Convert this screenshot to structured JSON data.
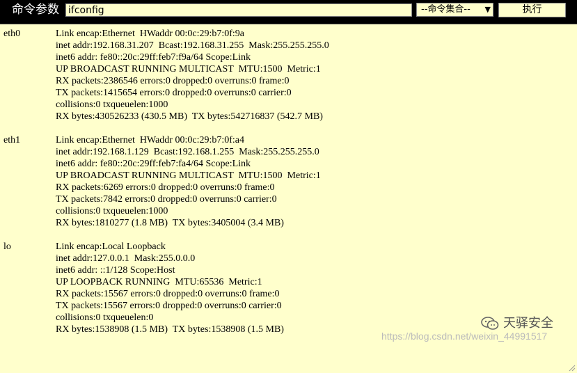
{
  "toolbar": {
    "label": "命令参数",
    "command_value": "ifconfig",
    "select_value": "--命令集合--",
    "exec_label": "执行"
  },
  "output": {
    "blocks": [
      {
        "iface": "eth0",
        "lines": [
          "Link encap:Ethernet  HWaddr 00:0c:29:b7:0f:9a",
          "inet addr:192.168.31.207  Bcast:192.168.31.255  Mask:255.255.255.0",
          "inet6 addr: fe80::20c:29ff:feb7:f9a/64 Scope:Link",
          "UP BROADCAST RUNNING MULTICAST  MTU:1500  Metric:1",
          "RX packets:2386546 errors:0 dropped:0 overruns:0 frame:0",
          "TX packets:1415654 errors:0 dropped:0 overruns:0 carrier:0",
          "collisions:0 txqueuelen:1000",
          "RX bytes:430526233 (430.5 MB)  TX bytes:542716837 (542.7 MB)"
        ]
      },
      {
        "iface": "eth1",
        "lines": [
          "Link encap:Ethernet  HWaddr 00:0c:29:b7:0f:a4",
          "inet addr:192.168.1.129  Bcast:192.168.1.255  Mask:255.255.255.0",
          "inet6 addr: fe80::20c:29ff:feb7:fa4/64 Scope:Link",
          "UP BROADCAST RUNNING MULTICAST  MTU:1500  Metric:1",
          "RX packets:6269 errors:0 dropped:0 overruns:0 frame:0",
          "TX packets:7842 errors:0 dropped:0 overruns:0 carrier:0",
          "collisions:0 txqueuelen:1000",
          "RX bytes:1810277 (1.8 MB)  TX bytes:3405004 (3.4 MB)"
        ]
      },
      {
        "iface": "lo",
        "lines": [
          "Link encap:Local Loopback",
          "inet addr:127.0.0.1  Mask:255.0.0.0",
          "inet6 addr: ::1/128 Scope:Host",
          "UP LOOPBACK RUNNING  MTU:65536  Metric:1",
          "RX packets:15567 errors:0 dropped:0 overruns:0 frame:0",
          "TX packets:15567 errors:0 dropped:0 overruns:0 carrier:0",
          "collisions:0 txqueuelen:0",
          "RX bytes:1538908 (1.5 MB)  TX bytes:1538908 (1.5 MB)"
        ]
      }
    ]
  },
  "watermark": {
    "brand": "天驿安全",
    "url": "https://blog.csdn.net/weixin_44991517",
    "icon": "wechat-icon"
  },
  "colors": {
    "output_bg": "#ffffcc",
    "topbar_bg": "#000000"
  }
}
